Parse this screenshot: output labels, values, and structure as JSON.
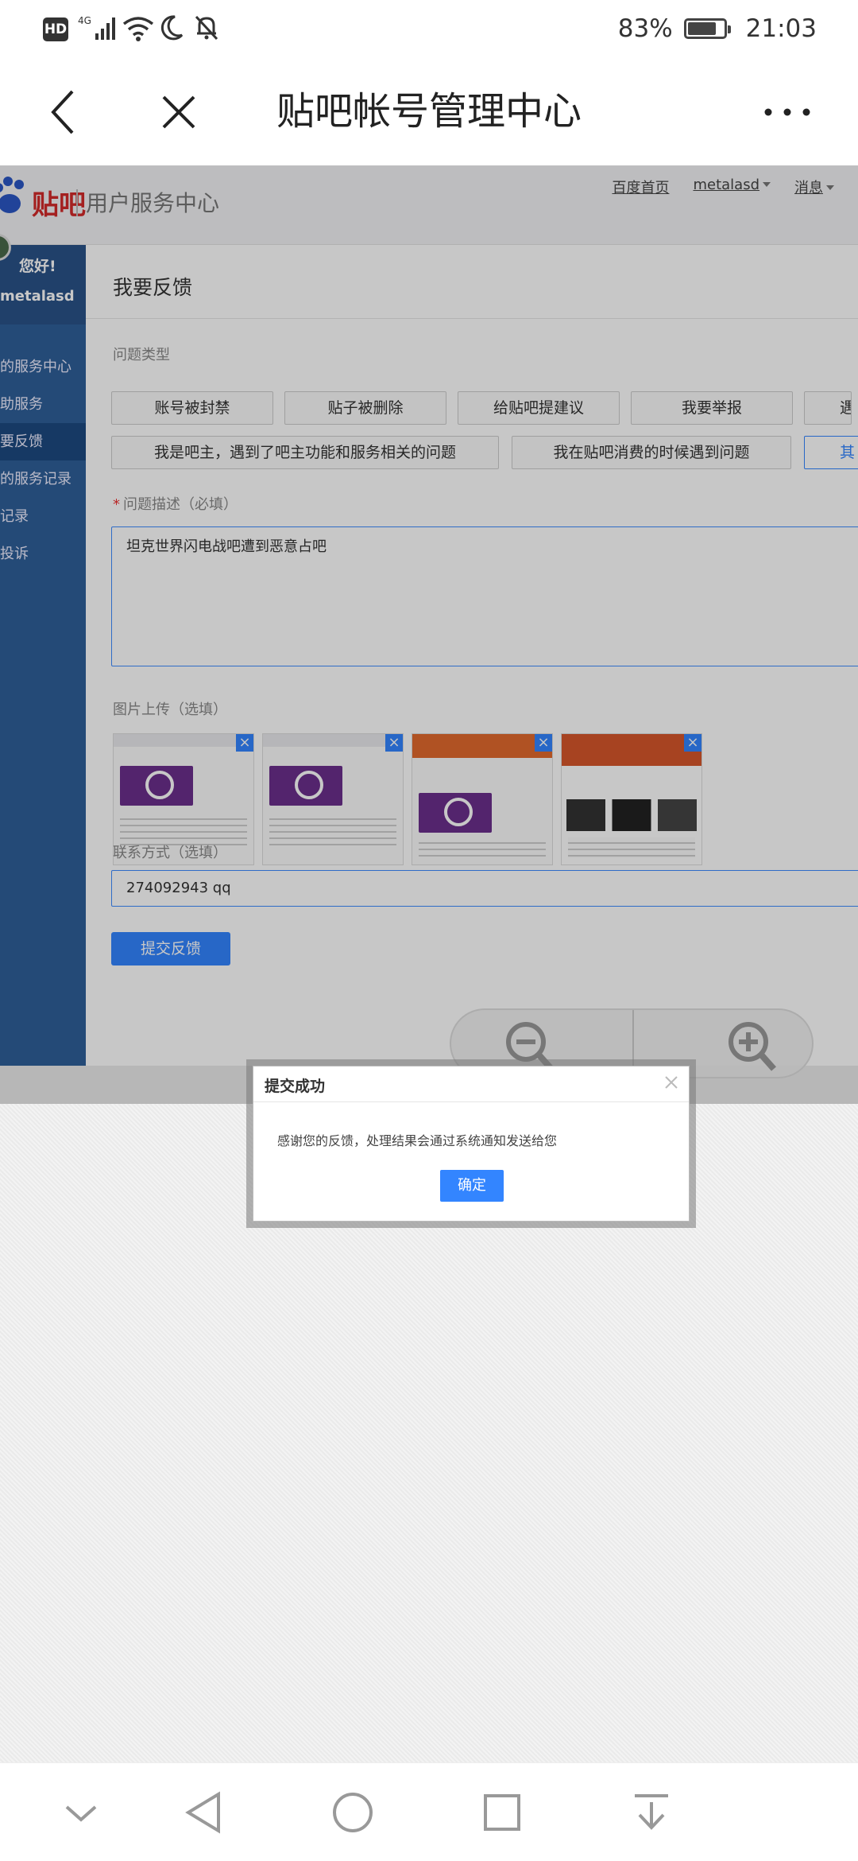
{
  "status_bar": {
    "hd": "HD",
    "network": "4G",
    "battery": "83%",
    "time": "21:03"
  },
  "title_bar": {
    "title": "贴吧帐号管理中心"
  },
  "site_header": {
    "logo": "贴吧",
    "subtitle": "用户服务中心",
    "links": [
      "百度首页",
      "metalasd",
      "消息"
    ]
  },
  "sidebar": {
    "greeting": "您好!",
    "username": "metalasd",
    "items": [
      {
        "label": "的服务中心"
      },
      {
        "label": "助服务"
      },
      {
        "label": "要反馈"
      },
      {
        "label": "的服务记录"
      },
      {
        "label": "记录"
      },
      {
        "label": "投诉"
      }
    ]
  },
  "form": {
    "page_title": "我要反馈",
    "type_label": "问题类型",
    "types_row1": [
      "账号被封禁",
      "贴子被删除",
      "给贴吧提建议",
      "我要举报",
      "遇"
    ],
    "types_row2": [
      "我是吧主，遇到了吧主功能和服务相关的问题",
      "我在贴吧消费的时候遇到问题",
      "其"
    ],
    "desc_required_mark": "*",
    "desc_label": "问题描述（必填）",
    "desc_value": "坦克世界闪电战吧遭到恶意占吧",
    "image_label": "图片上传（选填）",
    "contact_label": "联系方式（选填）",
    "contact_value": "274092943 qq",
    "submit": "提交反馈"
  },
  "dialog": {
    "title": "提交成功",
    "message": "感谢您的反馈，处理结果会通过系统通知发送给您",
    "ok": "确定"
  },
  "colors": {
    "accent": "#3385ff",
    "sidebar": "#2f5f99",
    "logo_red": "#d32a2a"
  }
}
